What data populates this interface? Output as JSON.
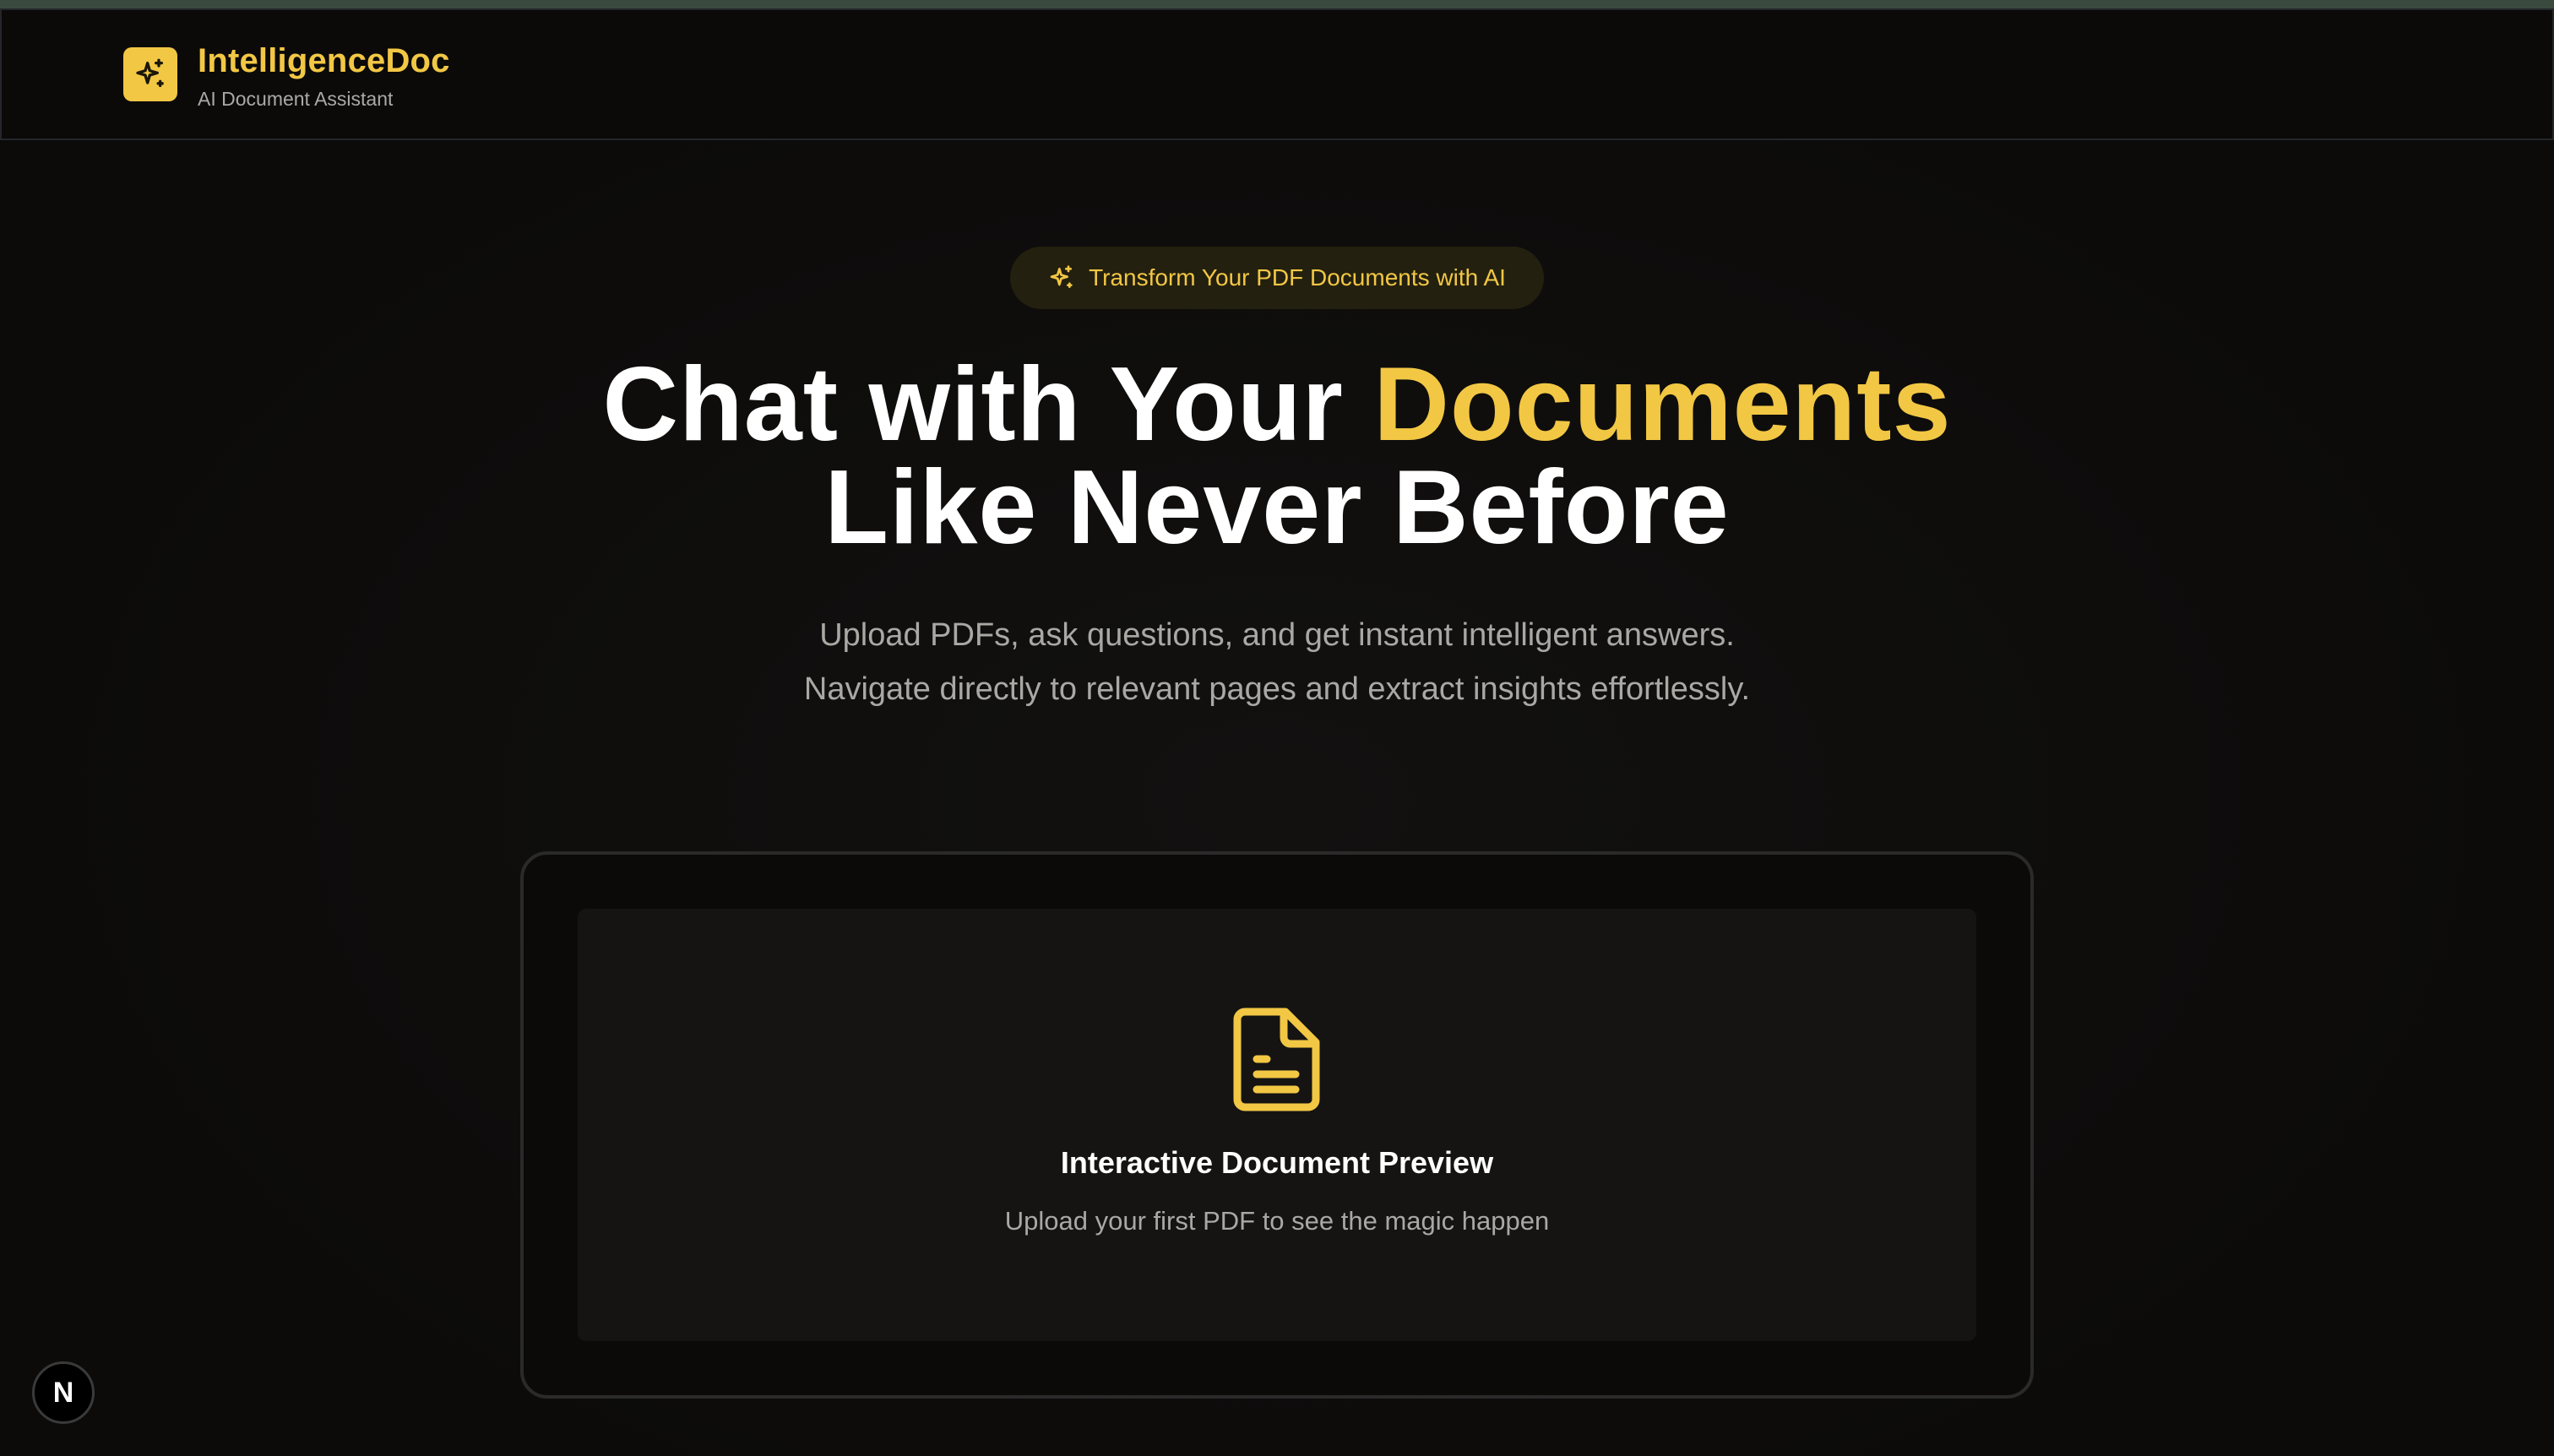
{
  "header": {
    "brand_title": "IntelligenceDoc",
    "brand_subtitle": "AI Document Assistant",
    "logo_icon": "sparkles-icon"
  },
  "hero": {
    "pill_icon": "sparkles-icon",
    "pill_text": "Transform Your PDF Documents with AI",
    "headline_part1": "Chat with Your ",
    "headline_accent": "Documents",
    "headline_line2": "Like Never Before",
    "subtitle_line1": "Upload PDFs, ask questions, and get instant intelligent answers.",
    "subtitle_line2": "Navigate directly to relevant pages and extract insights effortlessly."
  },
  "preview": {
    "icon": "document-icon",
    "title": "Interactive Document Preview",
    "subtitle": "Upload your first PDF to see the magic happen"
  },
  "dev_badge": {
    "label": "N"
  },
  "colors": {
    "accent": "#f2c744",
    "background": "#0e0d0c",
    "panel": "#151413",
    "muted_text": "#a9a8a4"
  }
}
